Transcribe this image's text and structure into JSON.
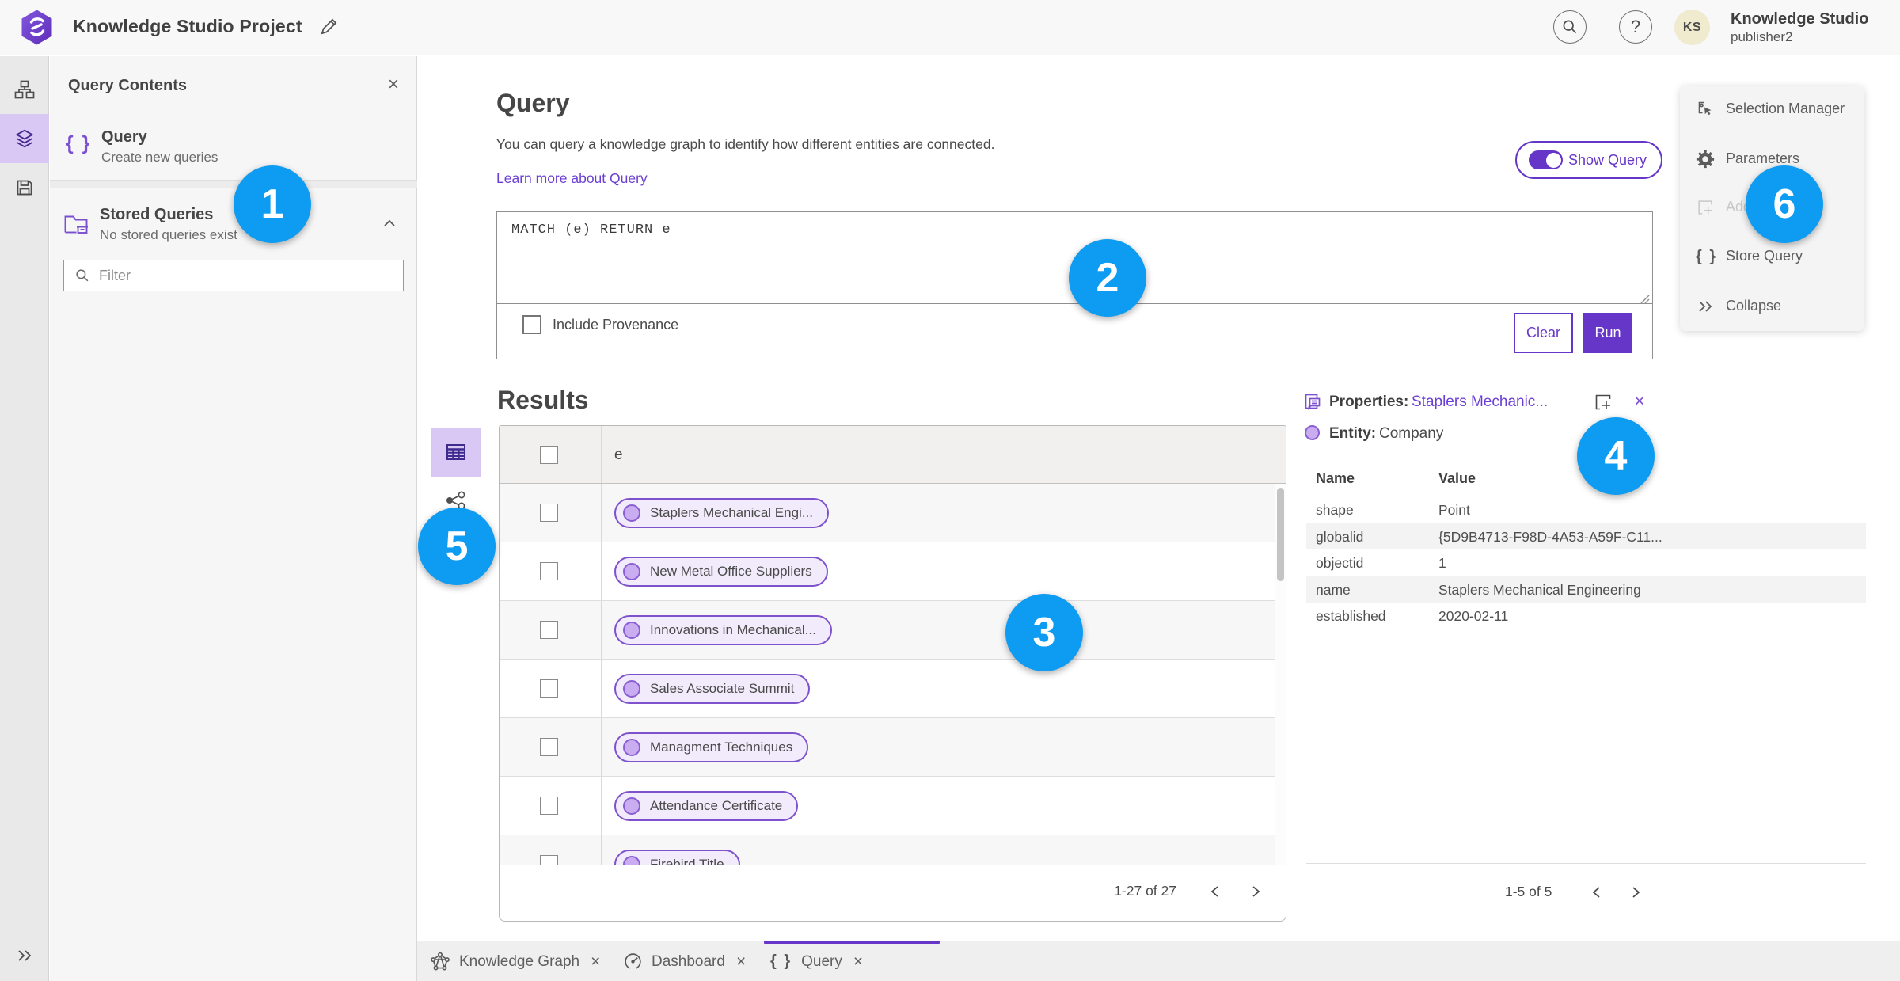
{
  "colors": {
    "brand": "#6636c9",
    "link": "#6b3fd4",
    "callout_blue": "#0d9cf2",
    "selected_nav_bg": "#d9c7f4",
    "pill_fill": "#f1ebfb",
    "pill_border": "#7e52cc"
  },
  "header": {
    "title": "Knowledge Studio Project",
    "user": {
      "name": "Knowledge Studio",
      "username": "publisher2",
      "initials": "KS"
    }
  },
  "left_panel": {
    "title": "Query Contents",
    "items": [
      {
        "title": "Query",
        "subtitle": "Create new queries"
      },
      {
        "title": "Stored Queries",
        "subtitle": "No stored queries exist"
      }
    ],
    "filter_placeholder": "Filter"
  },
  "query": {
    "title": "Query",
    "description": "You can query a knowledge graph to identify how different entities are connected.",
    "learn_more": "Learn more about Query",
    "show_query_label": "Show Query",
    "code": "MATCH (e) RETURN e",
    "include_provenance_label": "Include Provenance",
    "clear_label": "Clear",
    "run_label": "Run"
  },
  "results": {
    "title": "Results",
    "column_header": "e",
    "rows": [
      {
        "label": "Staplers Mechanical Engi..."
      },
      {
        "label": "New Metal Office Suppliers"
      },
      {
        "label": "Innovations in Mechanical..."
      },
      {
        "label": "Sales Associate Summit"
      },
      {
        "label": "Managment Techniques"
      },
      {
        "label": "Attendance Certificate"
      },
      {
        "label": "Firebird Title"
      }
    ],
    "pagination": "1-27 of 27"
  },
  "properties": {
    "title": "Properties:",
    "target": "Staplers Mechanic...",
    "entity_label": "Entity:",
    "entity_value": "Company",
    "columns": {
      "name": "Name",
      "value": "Value"
    },
    "rows": [
      {
        "name": "shape",
        "value": "Point"
      },
      {
        "name": "globalid",
        "value": "{5D9B4713-F98D-4A53-A59F-C11..."
      },
      {
        "name": "objectid",
        "value": "1"
      },
      {
        "name": "name",
        "value": "Staplers Mechanical Engineering"
      },
      {
        "name": "established",
        "value": "2020-02-11"
      }
    ],
    "pagination": "1-5 of 5"
  },
  "action_panel": {
    "items": [
      {
        "label": "Selection Manager"
      },
      {
        "label": "Parameters"
      },
      {
        "label": "Add To Map"
      },
      {
        "label": "Store Query"
      },
      {
        "label": "Collapse"
      }
    ]
  },
  "tabs": [
    {
      "label": "Knowledge Graph"
    },
    {
      "label": "Dashboard"
    },
    {
      "label": "Query"
    }
  ],
  "callouts": [
    "1",
    "2",
    "3",
    "4",
    "5",
    "6"
  ],
  "glyphs": {
    "close": "×",
    "help": "?",
    "braces": "{ }",
    "braces_small": "{ }"
  }
}
